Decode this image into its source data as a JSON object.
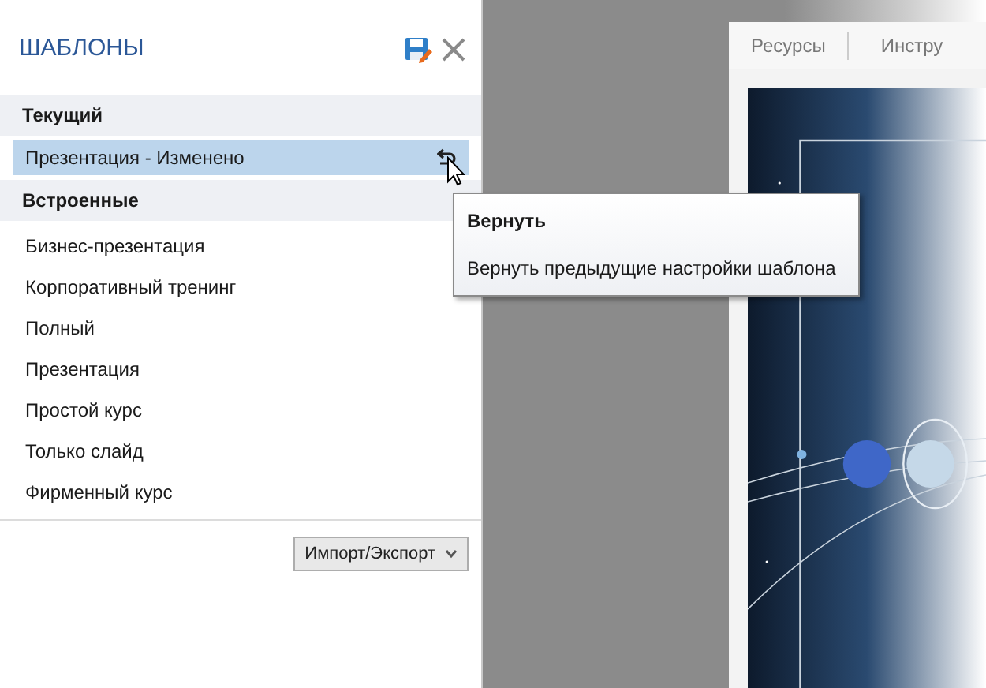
{
  "panel": {
    "title": "ШАБЛОНЫ",
    "sections": [
      {
        "heading": "Текущий",
        "items": [
          {
            "label": "Презентация - Изменено",
            "selected": true,
            "revert": true
          }
        ]
      },
      {
        "heading": "Встроенные",
        "items": [
          {
            "label": "Бизнес-презентация",
            "selected": false,
            "revert": false
          },
          {
            "label": "Корпоративный тренинг",
            "selected": false,
            "revert": false
          },
          {
            "label": "Полный",
            "selected": false,
            "revert": false
          },
          {
            "label": "Презентация",
            "selected": false,
            "revert": false
          },
          {
            "label": "Простой курс",
            "selected": false,
            "revert": false
          },
          {
            "label": "Только слайд",
            "selected": false,
            "revert": false
          },
          {
            "label": "Фирменный курс",
            "selected": false,
            "revert": false
          }
        ]
      }
    ],
    "import_export_button": "Импорт/Экспорт"
  },
  "tooltip": {
    "title": "Вернуть",
    "text": "Вернуть предыдущие настройки шаблона"
  },
  "preview": {
    "tabs": [
      "Ресурсы",
      "Инстру"
    ],
    "kind": "picture"
  }
}
